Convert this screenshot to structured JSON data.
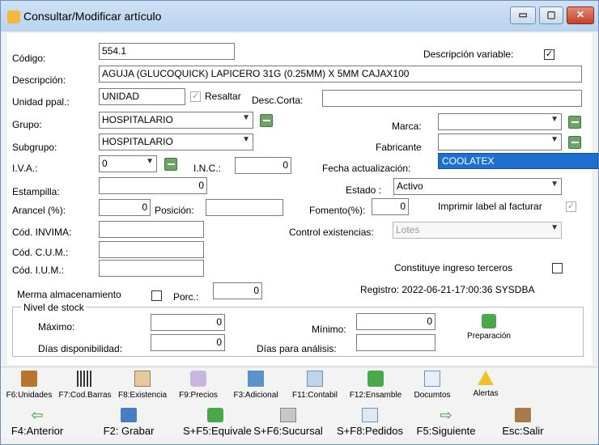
{
  "window": {
    "title": "Consultar/Modificar artículo",
    "minimize": "▭",
    "maximize": "▢",
    "close": "✕"
  },
  "form": {
    "codigo_label": "Código:",
    "codigo_value": "554.1",
    "desc_variable_label": "Descripción variable:",
    "desc_variable_checked": "✓",
    "descripcion_label": "Descripción:",
    "descripcion_value": "AGUJA (GLUCOQUICK) LAPICERO 31G (0.25MM) X 5MM  CAJAX100",
    "unidad_label": "Unidad ppal.:",
    "unidad_value": "UNIDAD",
    "resaltar_label": "Resaltar",
    "resaltar_checked": "✓",
    "desc_corta_label": "Desc.Corta:",
    "grupo_label": "Grupo:",
    "grupo_value": "HOSPITALARIO",
    "marca_label": "Marca:",
    "marca_value": "",
    "subgrupo_label": "Subgrupo:",
    "subgrupo_value": "HOSPITALARIO",
    "fabricante_label": "Fabricante",
    "fabricante_value": "",
    "fabricante_option": "COOLATEX",
    "iva_label": "I.V.A.:",
    "iva_value": "0",
    "inc_label": "I.N.C.:",
    "inc_value": "0",
    "fecha_label": "Fecha actualización:",
    "estampilla_label": "Estampilla:",
    "estampilla_value": "0",
    "estado_label": "Estado :",
    "estado_value": "Activo",
    "arancel_label": "Arancel (%):",
    "arancel_value": "0",
    "posicion_label": "Posición:",
    "fomento_label": "Fomento(%):",
    "fomento_value": "0",
    "imprimir_label": "Imprimir label al facturar",
    "imprimir_checked": "✓",
    "invima_label": "Cód. INVIMA:",
    "control_label": "Control existencias:",
    "control_value": "Lotes",
    "cum_label": "Cód. C.U.M.:",
    "ium_label": "Cód. I.U.M.:",
    "constituye_label": "Constituye ingreso terceros",
    "merma_label": "Merma almacenamiento",
    "porc_label": "Porc.:",
    "porc_value": "0",
    "registro_text": "Registro: 2022-06-21-17:00:36 SYSDBA",
    "stock_title": "Nivel de stock",
    "maximo_label": "Máximo:",
    "maximo_value": "0",
    "minimo_label": "Mínimo:",
    "minimo_value": "0",
    "dias_disp_label": "Días disponibilidad:",
    "dias_disp_value": "0",
    "dias_analisis_label": "Días para análisis:",
    "preparacion_label": "Preparación"
  },
  "toolbar": {
    "row1": [
      "F6:Unidades",
      "F7:Cod.Barras",
      "F8:Existencia",
      "F9:Precios",
      "F3:Adicional",
      "F11:Contabil",
      "F12:Ensamble",
      "Documtos",
      "Alertas"
    ],
    "row2": [
      "F4:Anterior",
      "F2: Grabar",
      "S+F5:Equivale",
      "S+F6:Sucursal",
      "S+F8:Pedidos",
      "F5:Siguiente",
      "Esc:Salir"
    ]
  }
}
